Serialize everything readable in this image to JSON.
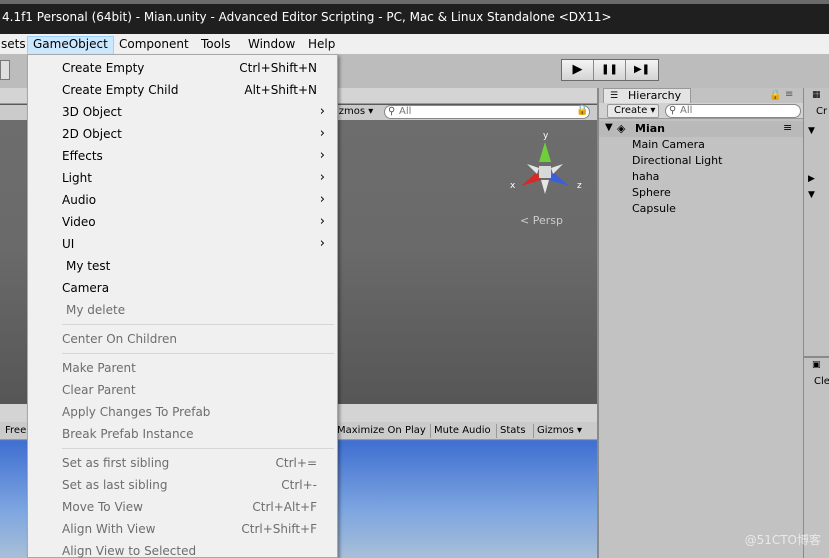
{
  "window": {
    "title": "4.1f1 Personal (64bit) - Mian.unity - Advanced Editor Scripting - PC, Mac & Linux Standalone <DX11>"
  },
  "menubar": {
    "items": [
      {
        "label": "sets"
      },
      {
        "label": "GameObject"
      },
      {
        "label": "Component"
      },
      {
        "label": "Tools"
      },
      {
        "label": "Window"
      },
      {
        "label": "Help"
      }
    ]
  },
  "playbar": {
    "play": "▶",
    "pause": "❚❚",
    "step": "▶❚"
  },
  "scene": {
    "gizmos_label": "izmos",
    "search_placeholder": "All",
    "persp_label": "Persp",
    "axis_x": "x",
    "axis_y": "y",
    "axis_z": "z"
  },
  "game": {
    "free_label": "Free",
    "maximize": "Maximize On Play",
    "mute": "Mute Audio",
    "stats": "Stats",
    "gizmos": "Gizmos"
  },
  "hierarchy": {
    "tab": "Hierarchy",
    "create": "Create",
    "search_placeholder": "All",
    "root": "Mian",
    "children": [
      "Main Camera",
      "Directional Light",
      "haha",
      "Sphere",
      "Capsule"
    ]
  },
  "right_panel": {
    "top_label": "Cr",
    "bottom_label": "Cle"
  },
  "watermark": "@51CTO博客",
  "dropdown": {
    "items": [
      {
        "label": "Create Empty",
        "shortcut": "Ctrl+Shift+N"
      },
      {
        "label": "Create Empty Child",
        "shortcut": "Alt+Shift+N"
      },
      {
        "label": "3D Object",
        "submenu": true
      },
      {
        "label": "2D Object",
        "submenu": true
      },
      {
        "label": "Effects",
        "submenu": true
      },
      {
        "label": "Light",
        "submenu": true
      },
      {
        "label": "Audio",
        "submenu": true
      },
      {
        "label": "Video",
        "submenu": true
      },
      {
        "label": "UI",
        "submenu": true
      },
      {
        "label": "My test"
      },
      {
        "label": "Camera"
      },
      {
        "label": "My delete",
        "disabled": true
      },
      {
        "label": "Center On Children",
        "disabled": true
      },
      {
        "label": "Make Parent",
        "disabled": true
      },
      {
        "label": "Clear Parent",
        "disabled": true
      },
      {
        "label": "Apply Changes To Prefab",
        "disabled": true
      },
      {
        "label": "Break Prefab Instance",
        "disabled": true
      },
      {
        "label": "Set as first sibling",
        "shortcut": "Ctrl+=",
        "disabled": true
      },
      {
        "label": "Set as last sibling",
        "shortcut": "Ctrl+-",
        "disabled": true
      },
      {
        "label": "Move To View",
        "shortcut": "Ctrl+Alt+F",
        "disabled": true
      },
      {
        "label": "Align With View",
        "shortcut": "Ctrl+Shift+F",
        "disabled": true
      },
      {
        "label": "Align View to Selected",
        "disabled": true
      }
    ]
  }
}
